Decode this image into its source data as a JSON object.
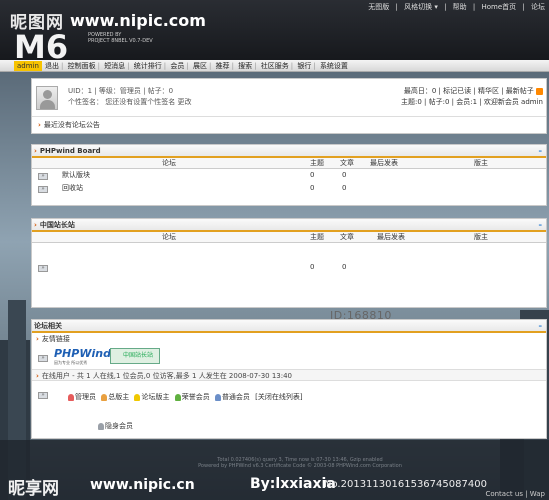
{
  "watermark": {
    "site": "昵图网",
    "url": "www.nipic.com",
    "bottom_site": "昵享网",
    "bottom_url": "www.nipic.cn",
    "author": "By:lxxiaxia",
    "id_text": "No.20131130161536745087400",
    "mid_id_text": "ID:168810 NO:20131130161536745087400"
  },
  "logo": {
    "text": "M6",
    "powered_by": "POWERED BY",
    "project": "PROJECT 8NBEL V0.7-DEV"
  },
  "toplinks": [
    "无图版",
    "风格切换 ▾",
    "帮助",
    "Home首页",
    "论坛"
  ],
  "nav": {
    "user": "admin",
    "items": [
      "退出",
      "控制面板",
      "短消息",
      "统计排行",
      "会员",
      "展区",
      "推荐",
      "搜索",
      "社区服务",
      "银行",
      "系统设置"
    ]
  },
  "user_panel": {
    "line1": "UID：1 | 等级：管理员 | 帖子：0",
    "line2": "个性签名： 您还没有设置个性签名 更改",
    "right1": "最高日：0 | 标记已读 | 精华区 | 最新帖子",
    "right2": "主题:0 | 帖子:0 | 会员:1 | 欢迎新会员 admin",
    "announcement": "最近没有论坛公告"
  },
  "columns": {
    "forum": "论坛",
    "topics": "主题",
    "posts": "文章",
    "last": "最后发表",
    "moderator": "版主"
  },
  "sections": [
    {
      "title": "PHPwind Board",
      "rows": [
        {
          "name": "默认版块",
          "topics": "0",
          "posts": "0"
        },
        {
          "name": "回收站",
          "topics": "0",
          "posts": "0"
        }
      ]
    },
    {
      "title": "中国站长站",
      "rows": [
        {
          "name": "",
          "topics": "0",
          "posts": "0"
        }
      ]
    }
  ],
  "related": {
    "title": "论坛相关",
    "links_label": "友情链接",
    "phpwind_logo": "PHPWind",
    "phpwind_slogan": "因为专业 所以优秀",
    "zz_logo": "中国站长站",
    "online": "在线用户 - 共 1 人在线,1 位会员,0 位访客,最多 1 人发生在 2008-07-30 13:40",
    "legend": [
      "管理员",
      "总版主",
      "论坛版主",
      "荣誉会员",
      "普通会员"
    ],
    "close_list": "[关闭在线列表]",
    "hidden_user": "隐身会员"
  },
  "footer": {
    "line1": "Total 0.027406(s) query 3, Time now is 07-30 13:46, Gzip enabled",
    "line2": "Powered by PHPWind v6.3 Certificate Code © 2003-08 PHPWind.com Corporation",
    "contact": "Contact us | Wap"
  },
  "colors": {
    "accent": "#e2a020",
    "nav_user_bg": "#f7c300",
    "link_blue": "#1e5fb4",
    "admin_icon": "#e65c5c",
    "super_mod_icon": "#e9a040",
    "mod_icon": "#f0c800",
    "honor_icon": "#60b040",
    "member_icon": "#6b8fc8",
    "hidden_icon": "#9aa0a8"
  }
}
